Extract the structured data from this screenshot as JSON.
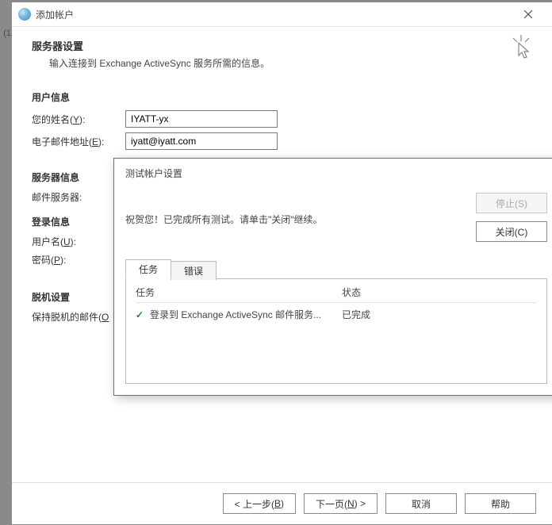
{
  "left_clipped_text": "(1",
  "window": {
    "title": "添加帐户"
  },
  "header": {
    "title": "服务器设置",
    "subtitle": "输入连接到 Exchange ActiveSync 服务所需的信息。"
  },
  "sections": {
    "user_info_title": "用户信息",
    "server_info_title": "服务器信息",
    "login_info_title": "登录信息",
    "offline_title": "脱机设置"
  },
  "labels": {
    "your_name": "您的姓名(",
    "your_name_u": "Y",
    "your_name_after": "):",
    "email": "电子邮件地址(",
    "email_u": "E",
    "email_after": "):",
    "mail_server": "邮件服务器:",
    "username": "用户名(",
    "username_u": "U",
    "username_after": "):",
    "password": "密码(",
    "password_u": "P",
    "password_after": "):",
    "keep_offline": "保持脱机的邮件(",
    "keep_offline_u": "O",
    "keep_offline_after": ""
  },
  "values": {
    "your_name": "IYATT-yx",
    "email": "iyatt@iyatt.com"
  },
  "footer": {
    "back": "< 上一步(",
    "back_u": "B",
    "back_after": ")",
    "next": "下一页(",
    "next_u": "N",
    "next_after": ") >",
    "cancel": "取消",
    "help": "帮助"
  },
  "test_dialog": {
    "title": "测试帐户设置",
    "message": "祝贺您！已完成所有测试。请单击\"关闭\"继续。",
    "stop_label": "停止(S)",
    "close_label": "关闭(C)",
    "tab_tasks": "任务",
    "tab_errors": "错误",
    "col_task": "任务",
    "col_status": "状态",
    "task_name": "登录到 Exchange ActiveSync 邮件服务...",
    "task_status": "已完成"
  }
}
